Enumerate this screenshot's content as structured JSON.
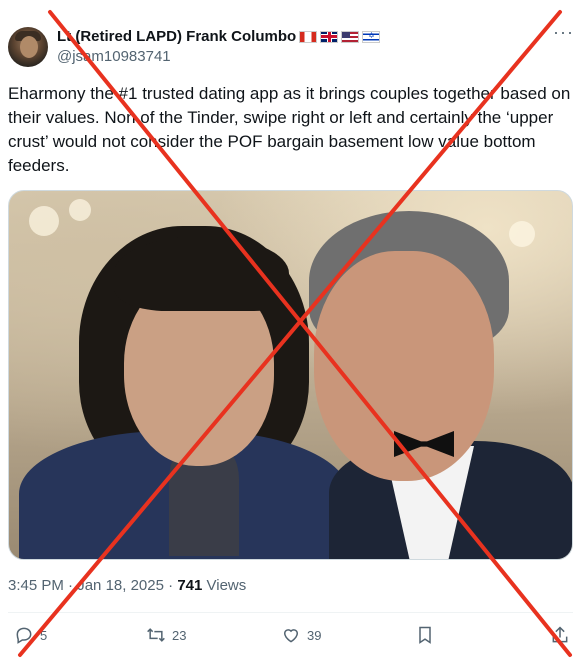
{
  "author": {
    "display_name": "Lt (Retired LAPD) Frank Columbo",
    "handle": "@jsam10983741"
  },
  "tweet": {
    "text": "Eharmony the #1 trusted dating app as it brings couples together based on their values. Non of the Tinder, swipe right or left and certainly the ‘upper crust’ would not consider the POF bargain basement low value bottom feeders.",
    "time": "3:45 PM",
    "separator": "·",
    "date": "Jan 18, 2025",
    "view_count": "741",
    "views_label": "Views"
  },
  "actions": {
    "replies": "5",
    "reposts": "23",
    "likes": "39"
  },
  "icons": {
    "avatar": "avatar",
    "flags": [
      "flag-canada-icon",
      "flag-uk-icon",
      "flag-usa-icon",
      "flag-israel-icon"
    ],
    "more": "more-icon",
    "reply": "reply-icon",
    "repost": "repost-icon",
    "like": "heart-icon",
    "bookmark": "bookmark-icon",
    "share": "share-icon"
  },
  "colors": {
    "cross_overlay": "#e8321f",
    "secondary_text": "#536471"
  }
}
